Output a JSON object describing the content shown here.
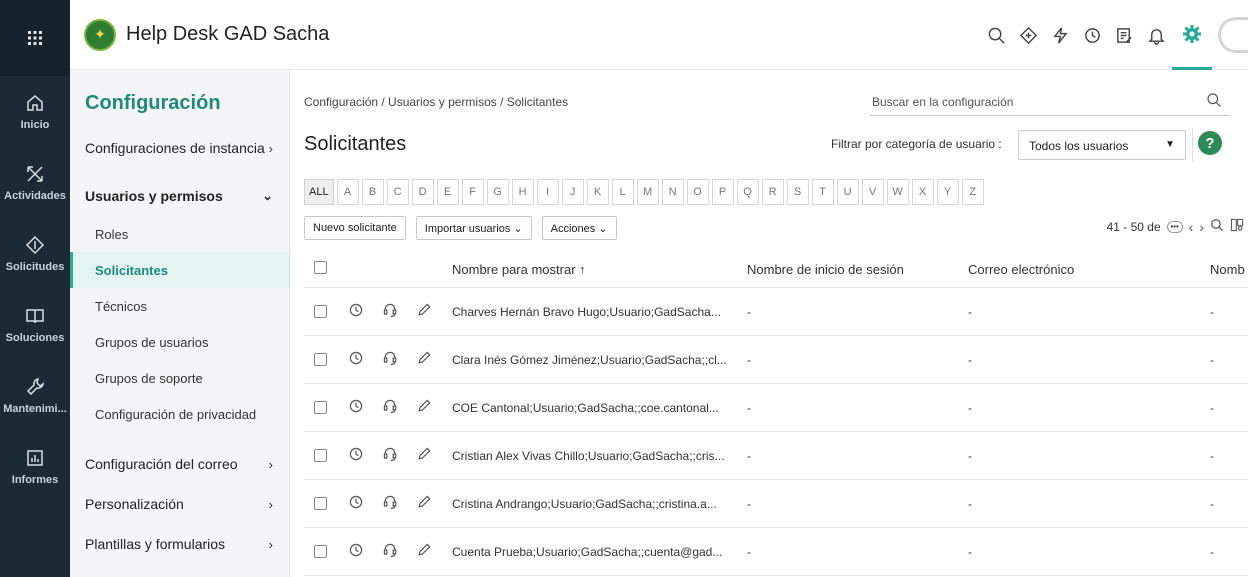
{
  "app": {
    "title": "Help Desk GAD Sacha"
  },
  "rail": [
    {
      "label": "Inicio",
      "icon": "home-icon"
    },
    {
      "label": "Actividades",
      "icon": "activities-icon"
    },
    {
      "label": "Solicitudes",
      "icon": "requests-icon"
    },
    {
      "label": "Soluciones",
      "icon": "solutions-icon"
    },
    {
      "label": "Mantenimi...",
      "icon": "wrench-icon"
    },
    {
      "label": "Informes",
      "icon": "reports-icon"
    }
  ],
  "setnav": {
    "title": "Configuración",
    "instance": "Configuraciones de instancia",
    "users": "Usuarios y permisos",
    "sub": [
      "Roles",
      "Solicitantes",
      "Técnicos",
      "Grupos de usuarios",
      "Grupos de soporte",
      "Configuración de privacidad"
    ],
    "mail": "Configuración del correo",
    "custom": "Personalización",
    "templates": "Plantillas y formularios"
  },
  "main": {
    "breadcrumb": "Configuración / Usuarios y permisos / Solicitantes",
    "search_placeholder": "Buscar en la configuración",
    "title": "Solicitantes",
    "filter_label": "Filtrar por categoría de usuario :",
    "filter_value": "Todos los usuarios",
    "help": "?",
    "alpha": [
      "ALL",
      "A",
      "B",
      "C",
      "D",
      "E",
      "F",
      "G",
      "H",
      "I",
      "J",
      "K",
      "L",
      "M",
      "N",
      "O",
      "P",
      "Q",
      "R",
      "S",
      "T",
      "U",
      "V",
      "W",
      "X",
      "Y",
      "Z"
    ],
    "btn_new": "Nuevo solicitante",
    "btn_import": "Importar usuarios ⌄",
    "btn_actions": "Acciones ⌄",
    "pager": "41 - 50 de",
    "columns": {
      "display_name": "Nombre para mostrar ↑",
      "login": "Nombre de inicio de sesión",
      "email": "Correo electrónico",
      "last": "Nomb"
    },
    "rows": [
      {
        "name": "Charves Hernán Bravo Hugo;Usuario;GadSacha...",
        "login": "-",
        "email": "-",
        "last": "-"
      },
      {
        "name": "Clara Inés Gómez Jiménez;Usuario;GadSacha;;cl...",
        "login": "-",
        "email": "-",
        "last": "-"
      },
      {
        "name": "COE Cantonal;Usuario;GadSacha;;coe.cantonal...",
        "login": "-",
        "email": "-",
        "last": "-"
      },
      {
        "name": "Cristian Alex Vivas Chillo;Usuario;GadSacha;;cris...",
        "login": "-",
        "email": "-",
        "last": "-"
      },
      {
        "name": "Cristina Andrango;Usuario;GadSacha;;cristina.a...",
        "login": "-",
        "email": "-",
        "last": "-"
      },
      {
        "name": "Cuenta Prueba;Usuario;GadSacha;;cuenta@gad...",
        "login": "-",
        "email": "-",
        "last": "-"
      }
    ]
  },
  "colors": {
    "accent": "#2aa89a",
    "rail": "#1b2a35",
    "help": "#2e8b57"
  }
}
